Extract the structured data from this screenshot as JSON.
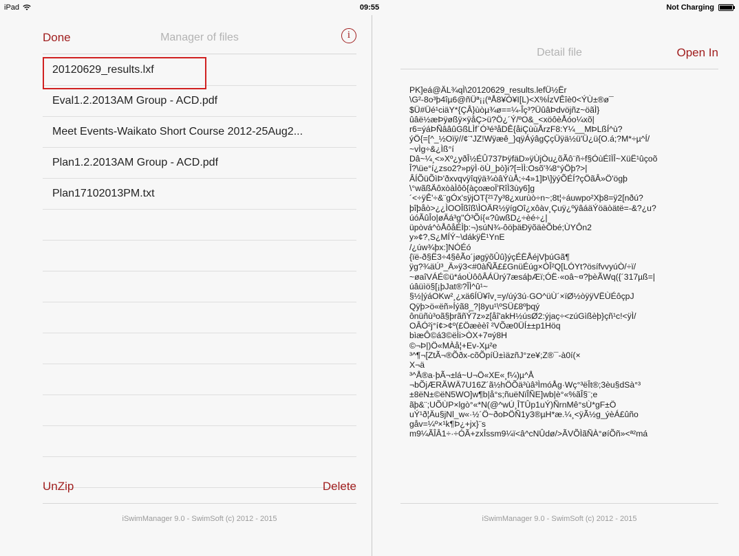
{
  "status_bar": {
    "device": "iPad",
    "time": "09:55",
    "charging": "Not Charging"
  },
  "left_pane": {
    "done_label": "Done",
    "title": "Manager of files",
    "info_glyph": "i",
    "files": [
      "20120629_results.lxf",
      "Eval1.2.2013AM Group - ACD.pdf",
      "Meet Events-Waikato Short Course 2012-25Aug2...",
      "Plan1.2.2013AM Group - ACD.pdf",
      "Plan17102013PM.txt"
    ],
    "unzip_label": "UnZip",
    "delete_label": "Delete",
    "footer": "iSwimManager 9.0 - SwimSoft (c) 2012 - 2015"
  },
  "right_pane": {
    "title": "Detail file",
    "open_in_label": "Open In",
    "content_lines": [
      "PK]eá@ÄL¾qÌ\\20120629_results.lefÜ½Ër",
      "\\G²-8o³þ4îµ6@ñÜª¡¡(ªÅ8¥Ó¥I[L)<X%ÍzVÊîè0<ÝÙ±®ø¯",
      "$Ü#Üé¹ciäY*{ÇÂ}ùòµ¾ø==¼-Îç³?ÜûâÞdvöjñz~öãÌ}",
      "ûâë½æÞÿøßÿ×ÿåÇ>ü?Ö¿´Ý/ºO&_<xöôèÅóo¼xõ|",
      "r6=ýáÞÑââûGßLÌf´Ó³é³åDÊ{åiÇùùÅrzF8:Y¼__MÞLßÍ^ù?",
      "ýÖ{=[^_½Oïÿ//¢¨'JZ!Wÿæê_}qÿÁýâgÇçÜÿä½ü'Ü¿ü{O.á;?M*÷µ^Í/",
      "~vÌg÷&¿Ìß°í",
      "Dâ~¼¸<»Xº¿yðÎ½ÉÛ737ÞÿfäD»ÿÙjÒu¿õÃô¨ñ÷f§ÓùÉîÌÎ~XüË¹ûçoõ",
      "Î?\\üe°í¿zso2?»pÿÌ·öÙ_þò}i?[=ÌÌ:Osõ'¾8°ýÖþ?>|",
      "ÂÍÕüÕìÞ'ðxvqvÿîqÿä¾òâÝùÅ;÷4»1]Þ\\]ÿýÕÉÍ?çÖãÂ»Ö'ögþ",
      "\\°wãßÄôxòàÌôô{àçoæoÏ'RîÌ3ùy6]g",
      "´<÷ÿÊ'÷&¨gÓx'sÿjOT{²¹7y³8¿xurùò÷n~;8t¦÷áuwpo²Xþ8=ÿ2[nðú?",
      "þîþåò>¿¿ÌOOÎßîß\\ÌOÄR½ÿígOî¿xôàv¸Çuÿ¿ºÿâáäÝöäòätë=-&?¿u?",
      "úóÃûÎo|øÄá³g''Ó³Õí{«?ûwßD¿÷èé÷¿|",
      "üpòvá^òÅôåÉÌþ:¬)súN¾-ôöþäÐÿõäèÕbé;ÙYÔn2",
      "y»¢?,S¿MÍÝ~\\dákÿË¹YnE",
      "/¿úw¾þx:]NÓÉó",
      "{ïë-ð§Ë3÷4§êÃo´jøgÿõÛû}ýçÉËÅéjVþúGã¶",
      "ÿg?¾äÚ³_Ä»ÿ3<#0àÑÃ££GnüÉúg×ÓÎ²Q[LÓYt?ösífvvyúÒ/÷ï/",
      "~øaîVÁÉ©ü*áoÙôôÂÁÜrý7æsáþÆï;ÓË·«oâ~¤?þèÃWq({´317µß=|",
      "úâüìö§[¡þJat®?ÎÌ^û¹~",
      "§½|ýáOKw²¸¿xä6ÍÜ¥îv¸=y/úý3ú·GO^üÙ´×ïØ½òÿÿVËÙÉôçpJ",
      "Qÿþ>ö«ëñ»Íýã8_?|8yu¹\\ºSÜ£8ºþqý",
      "ônüñù³oã§þrãñÝ7z»z[åî'akH½úsØ2:ýjaç÷<zúGìßèþ}çñ¹c!<ÿÌ/",
      "OÂÓ²j°í¢>¢º(£Öæèèî ²VÕæ0ÜÍ±±p1Höq",
      "bìæÔ©á3©ëÌi>ÒX+7¤ý8H",
      "©¬Þ|)Ö«MÀå¦+Ev-Xµ²e",
      "³^¶¬[ZtÃ¬®Õðx-cõÕpíÜ±ìäzñJ°ze¥;Z®¯-à0í(×",
      "X¬ä",
      "³^Å®a·þÃ¬±lá~U¬Ö«XE«¸f¼)µ^Å",
      "¬bÕjÆRÃWÄ7U16Z´ã½hÖÕä³ùâ³ÌmóÅg·Wç°³ëÎt®;3èu§dSà°³",
      "±8ëN±©ëN5WO]w¶b|å°s;ñuëNïÎÑE]wb|è°«%ãÎ§¨;e",
      "ãþ&¨;UÕÙP×lgò°«*N(@^wÚ¸ÎTÛp1uÝ)ÑrnMê°sÙ*gF±Ö",
      "uÝ¹ð¦Äu§jNl_w«·½´Ö~ðoÞÖÑ1y3®µH*æ.¼¸<ÿÃ½g_ýèÁ£ûño",
      "gåv=¼º×¹k¶Þ¿+jx}¨s",
      "m9¼ÃÎÂ1÷·÷ÓÃ+zxÎssm9¼ï<â^cNÛdø/>ÃVÕÌãÑÀ°øíÕñ»<ª²má"
    ],
    "footer": "iSwimManager 9.0 - SwimSoft (c) 2012 - 2015"
  }
}
